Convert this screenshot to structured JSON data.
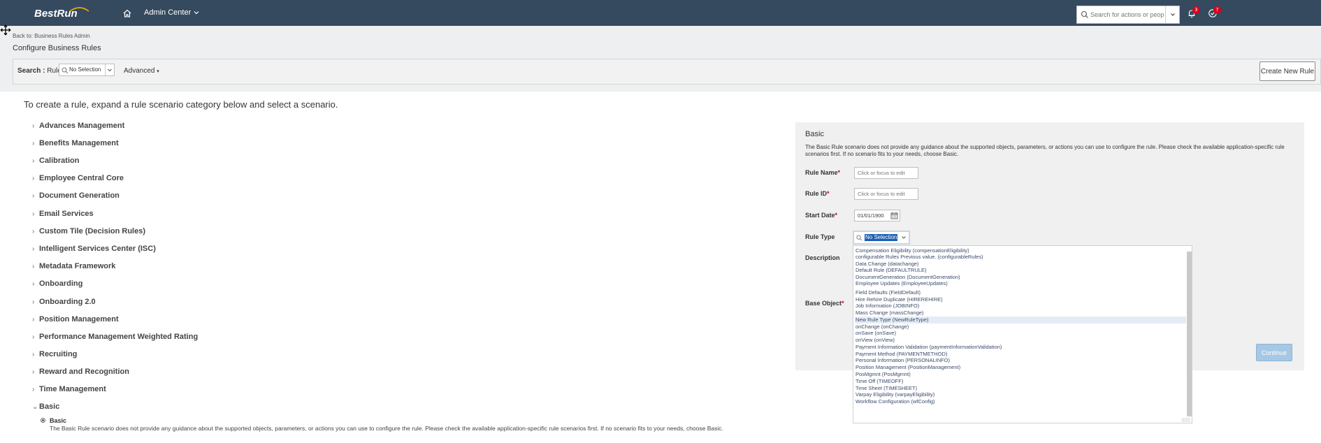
{
  "header": {
    "logo_text": "BestRun",
    "module_name": "Admin Center",
    "search_placeholder": "Search for actions or people",
    "notifications_count": "3",
    "todo_count": "7",
    "colors": {
      "shellbar": "#354a5f",
      "badge": "#d9001b"
    }
  },
  "subheader": {
    "back_link": "Back to: Business Rules Admin",
    "page_title": "Configure Business Rules",
    "search_label": "Search :",
    "search_type": "Rule",
    "search_value": "No Selection",
    "advanced_label": "Advanced",
    "create_button": "Create New Rule"
  },
  "main": {
    "intro": "To create a rule, expand a rule scenario category below and select a scenario.",
    "categories": [
      "Advances Management",
      "Benefits Management",
      "Calibration",
      "Employee Central Core",
      "Document Generation",
      "Email Services",
      "Custom Tile (Decision Rules)",
      "Intelligent Services Center (ISC)",
      "Metadata Framework",
      "Onboarding",
      "Onboarding 2.0",
      "Position Management",
      "Performance Management Weighted Rating",
      "Recruiting",
      "Reward and Recognition",
      "Time Management",
      "Basic"
    ],
    "basic_option": "Basic",
    "basic_description": "The Basic Rule scenario does not provide any guidance about the supported objects, parameters, or actions you can use to configure the rule. Please check the available application-specific rule scenarios first. If no scenario fits to your needs, choose Basic."
  },
  "panel": {
    "title": "Basic",
    "description": "The Basic Rule scenario does not provide any guidance about the supported objects, parameters, or actions you can use to configure the rule. Please check the available application-specific rule scenarios first. If no scenario fits to your needs, choose Basic.",
    "rule_name_label": "Rule Name",
    "rule_id_label": "Rule ID",
    "start_date_label": "Start Date",
    "rule_type_label": "Rule Type",
    "description_label": "Description",
    "base_object_label": "Base Object",
    "required_mark": "*",
    "edit_placeholder": "Click or focus to edit",
    "start_date_value": "01/01/1900",
    "rule_type_value": "No Selection",
    "continue_button": "Continue"
  },
  "rule_type_options": [
    "Compensation Eligibility (compensationEligibility)",
    "configurable Rules  Previous value. (configurableRules)",
    "Data Change (datachange)",
    "Default Rule (DEFAULTRULE)",
    "DocumentGeneration (DocumentGeneration)",
    "Employee Updates (EmployeeUpdates)",
    "Field Defaults (FieldDefault)",
    "Hire Rehire Duplicate (HIREREHIRE)",
    "Job Information (JOBINFO)",
    "Mass Change (massChange)",
    "New Rule Type (NewRuleType)",
    "onChange (onChange)",
    "onSave (onSave)",
    "onView (onView)",
    "Payment Information Validation (paymentInformationValidation)",
    "Payment Method (PAYMENTMETHOD)",
    "Personal Information (PERSONALINFO)",
    "Position Management (PositionManagement)",
    "PosMgmnt (PosMgmnt)",
    "Time Off (TIMEOFF)",
    "Time Sheet (TIMESHEET)",
    "Varpay Eligibility (varpayEligibility)",
    "Workflow Configuration (wfConfig)"
  ],
  "highlighted_option": "New Rule Type (NewRuleType)"
}
